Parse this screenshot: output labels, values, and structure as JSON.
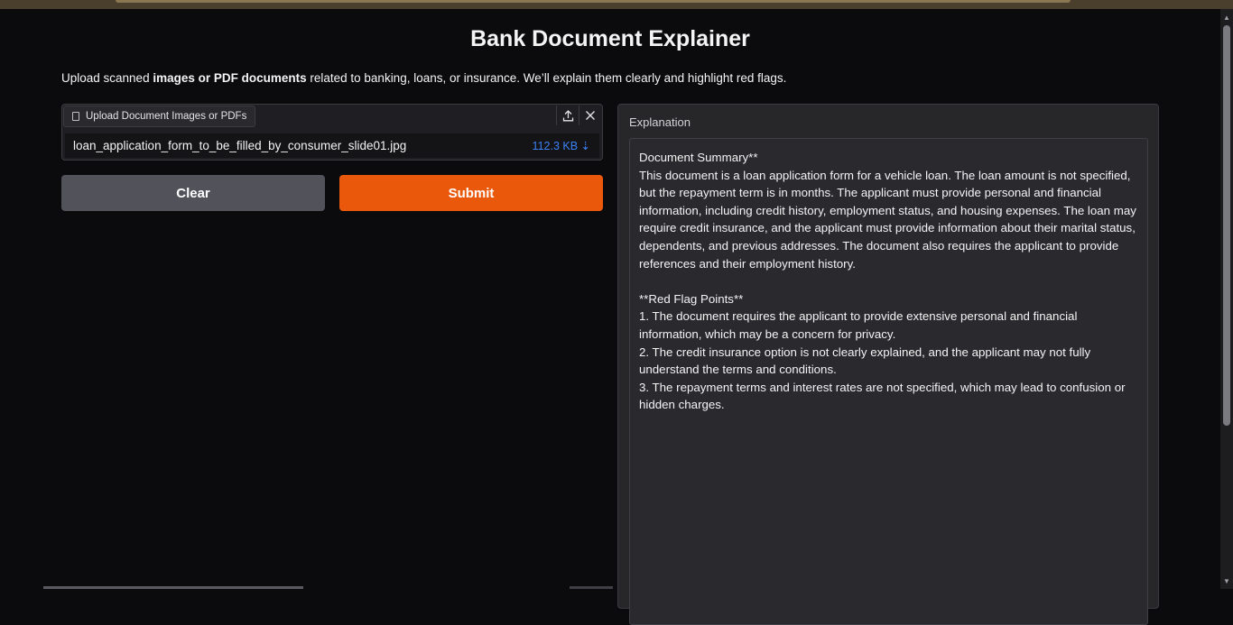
{
  "page": {
    "title": "Bank Document Explainer",
    "intro_prefix": "Upload scanned ",
    "intro_bold": "images or PDF documents",
    "intro_suffix": " related to banking, loans, or insurance. We’ll explain them clearly and highlight red flags."
  },
  "upload": {
    "label": "Upload Document Images or PDFs",
    "file_name": "loan_application_form_to_be_filled_by_consumer_slide01.jpg",
    "file_size": "112.3 KB ⇣"
  },
  "actions": {
    "clear_label": "Clear",
    "submit_label": "Submit"
  },
  "output": {
    "label": "Explanation",
    "text": "Document Summary**\nThis document is a loan application form for a vehicle loan. The loan amount is not specified, but the repayment term is in months. The applicant must provide personal and financial information, including credit history, employment status, and housing expenses. The loan may require credit insurance, and the applicant must provide information about their marital status, dependents, and previous addresses. The document also requires the applicant to provide references and their employment history.\n\n**Red Flag Points**\n1. The document requires the applicant to provide extensive personal and financial information, which may be a concern for privacy.\n2. The credit insurance option is not clearly explained, and the applicant may not fully understand the terms and conditions.\n3. The repayment terms and interest rates are not specified, which may lead to confusion or hidden charges."
  },
  "colors": {
    "background": "#0b0b0d",
    "primary": "#ea580c",
    "secondary": "#52525b",
    "panel": "#27272a",
    "link": "#3b82f6"
  },
  "icons": {
    "file": "file-icon",
    "upload": "upload-icon",
    "close": "close-icon"
  }
}
